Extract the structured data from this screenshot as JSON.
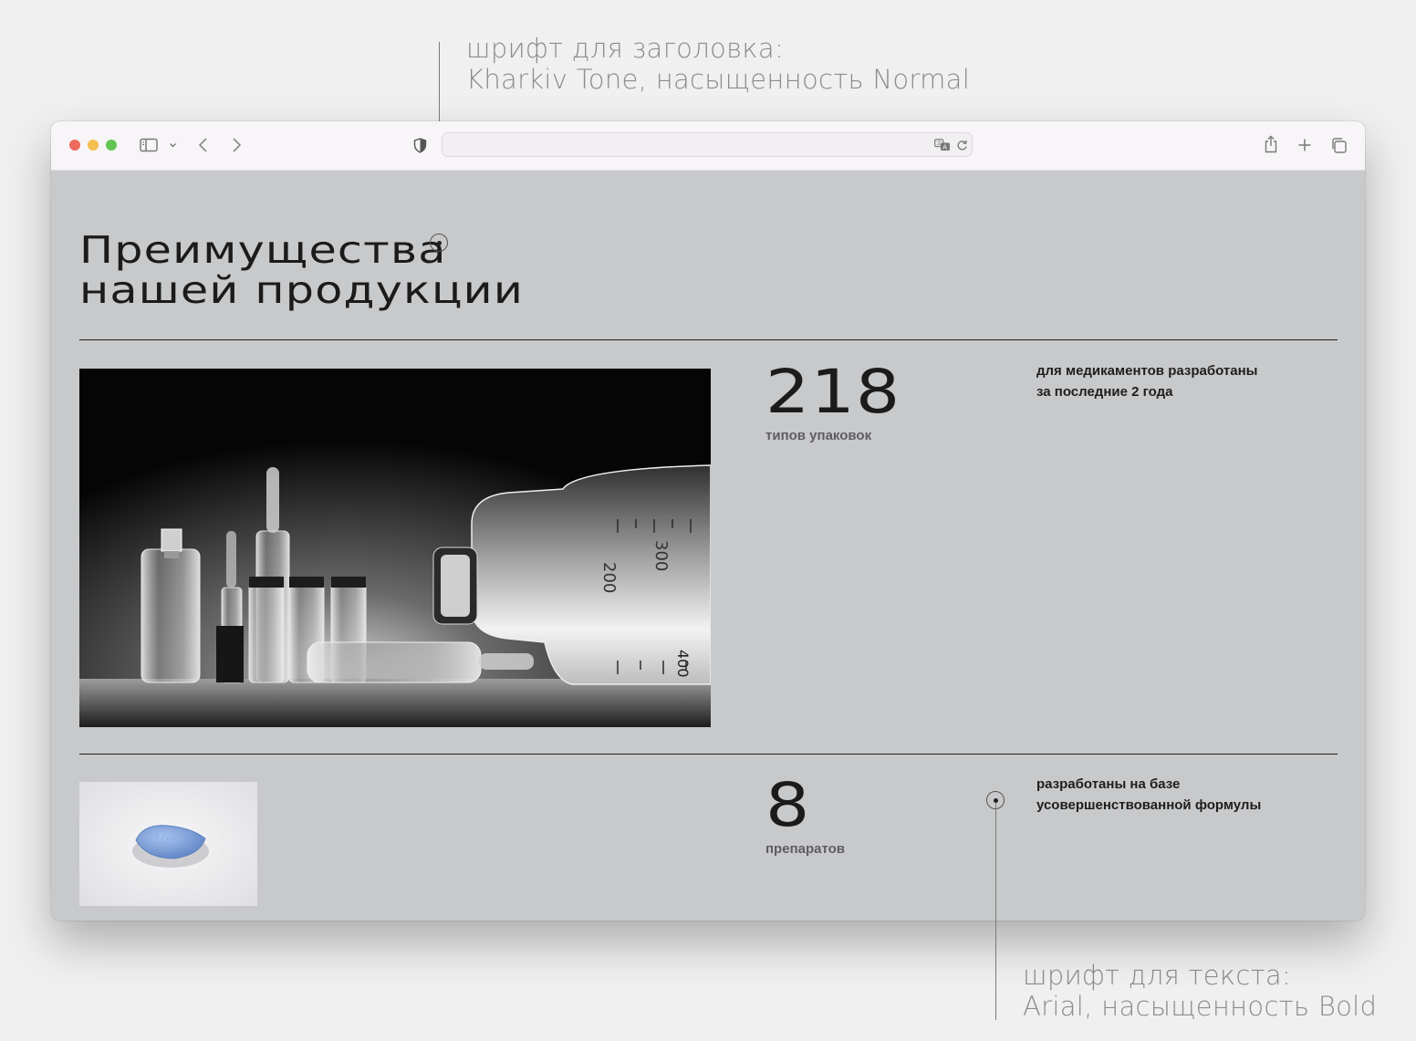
{
  "annotations": {
    "heading_font": {
      "line1": "шрифт для заголовка:",
      "line2": "Kharkiv Tone, насыщенность Normal"
    },
    "text_font": {
      "line1": "шрифт для текста:",
      "line2": "Arial, насыщенность Bold"
    }
  },
  "browser": {
    "url": "",
    "icons": [
      "sidebar-icon",
      "chevron-down-icon",
      "back-icon",
      "forward-icon",
      "shield-icon",
      "translate-icon",
      "reload-icon",
      "share-icon",
      "new-tab-icon",
      "tabs-overview-icon"
    ]
  },
  "page": {
    "heading_line1": "Преимущества",
    "heading_line2": "нашей продукции",
    "stats": [
      {
        "number": "218",
        "label": "типов упаковок",
        "description": "для медикаментов разработаны за последние 2 года",
        "description_line1": "для медикаментов разработаны",
        "description_line2": "за последние 2 года"
      },
      {
        "number": "8",
        "label": "препаратов",
        "description": "разработаны на базе усовершенствованной формулы",
        "description_line1": "разработаны на базе",
        "description_line2": "усовершенствованной формулы"
      }
    ],
    "pill_imprint": "100",
    "photo_vials_marks": [
      "400",
      "300",
      "200"
    ]
  },
  "colors": {
    "page_background": "#c8c9cb",
    "text": "#1b1b1b",
    "muted_text": "#5e5e60",
    "annotation": "#8c8c8c",
    "pill": "#7a9fd8"
  }
}
